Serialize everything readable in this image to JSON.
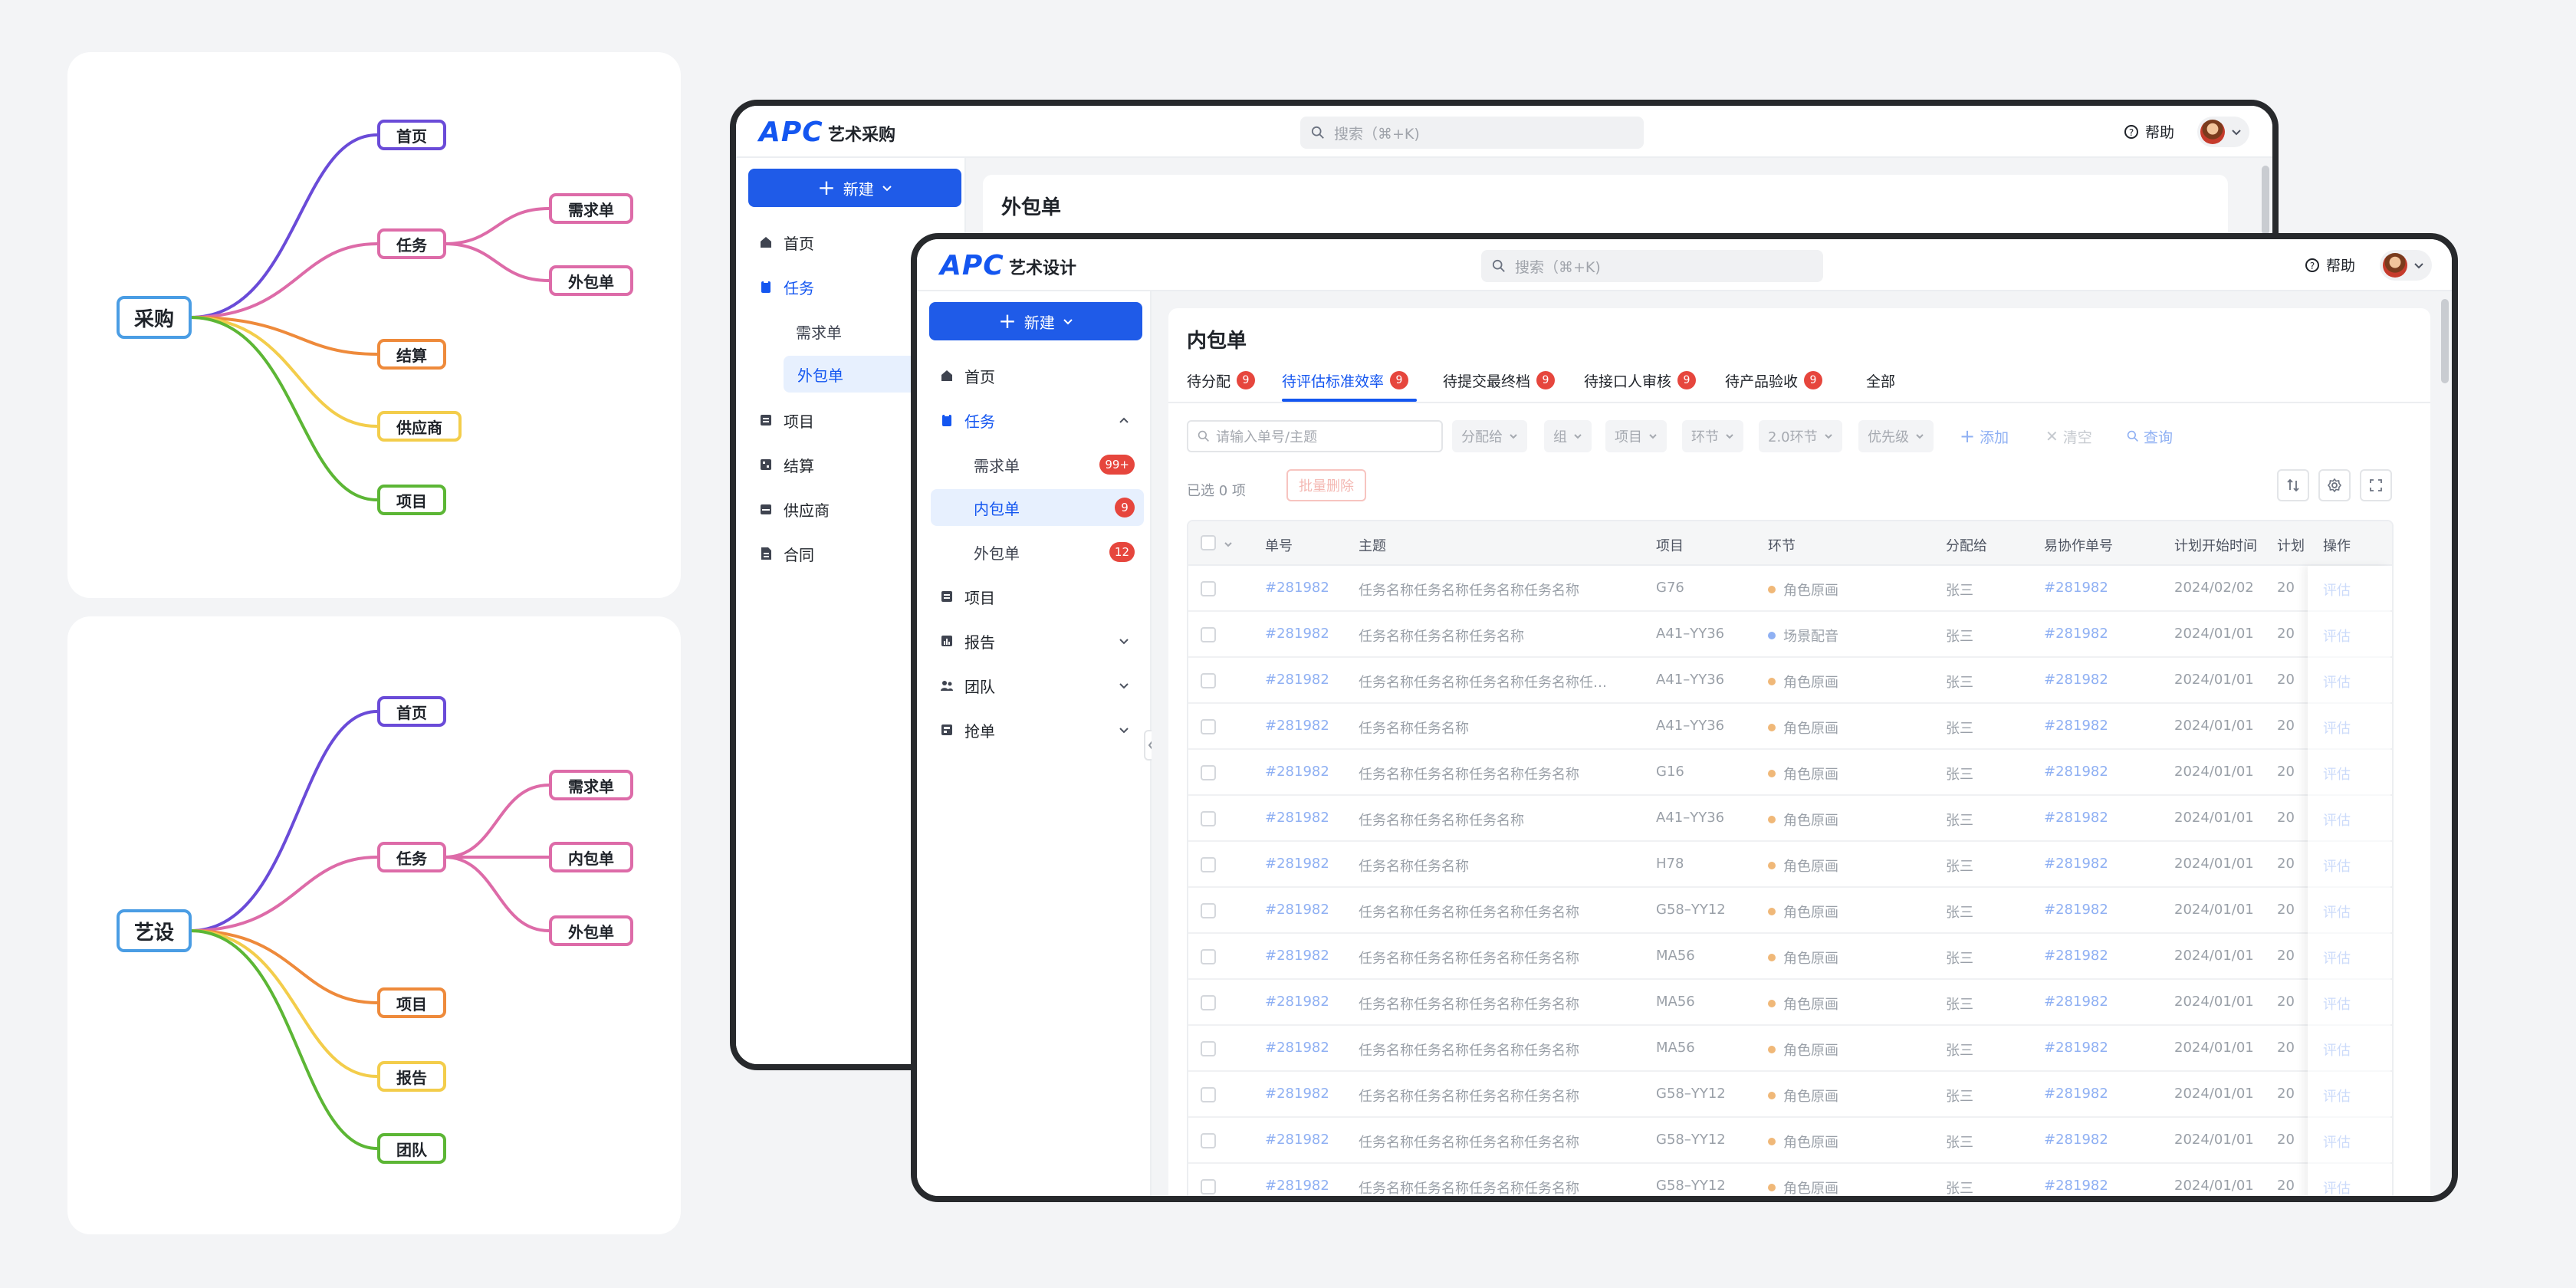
{
  "mindmaps": {
    "procurement": {
      "root": "采购",
      "nodes": [
        "首页",
        "任务",
        "需求单",
        "外包单",
        "结算",
        "供应商",
        "项目"
      ]
    },
    "design": {
      "root": "艺设",
      "nodes": [
        "首页",
        "任务",
        "需求单",
        "内包单",
        "外包单",
        "项目",
        "报告",
        "团队"
      ]
    }
  },
  "colors": {
    "accent": "#1456f0",
    "badge": "#e6463d",
    "frame": "#27292c",
    "branch_purple": "#6a4bd8",
    "branch_pink": "#dd6ba8",
    "branch_orange": "#ee8a3b",
    "branch_yellow": "#f3cd4b",
    "branch_green": "#5cb635",
    "root_blue": "#4a9de4"
  },
  "back_window": {
    "logo": "APC",
    "app_title": "艺术采购",
    "search_placeholder": "搜索（⌘+K)",
    "help": "帮助",
    "new_button": "新建",
    "nav": [
      {
        "label": "首页",
        "icon": "home-icon"
      },
      {
        "label": "任务",
        "icon": "task-icon"
      },
      {
        "label": "需求单"
      },
      {
        "label": "外包单"
      },
      {
        "label": "项目",
        "icon": "project-icon"
      },
      {
        "label": "结算",
        "icon": "settlement-icon"
      },
      {
        "label": "供应商",
        "icon": "supplier-icon"
      },
      {
        "label": "合同",
        "icon": "contract-icon"
      }
    ],
    "page_title": "外包单"
  },
  "front_window": {
    "logo": "APC",
    "app_title": "艺术设计",
    "search_placeholder": "搜索（⌘+K)",
    "help": "帮助",
    "new_button": "新建",
    "nav": [
      {
        "label": "首页",
        "icon": "home-icon"
      },
      {
        "label": "任务",
        "icon": "task-icon"
      },
      {
        "label": "需求单",
        "badge": "99+"
      },
      {
        "label": "内包单",
        "badge": "9"
      },
      {
        "label": "外包单",
        "badge": "12"
      },
      {
        "label": "项目",
        "icon": "project-icon"
      },
      {
        "label": "报告",
        "icon": "report-icon"
      },
      {
        "label": "团队",
        "icon": "team-icon"
      },
      {
        "label": "抢单",
        "icon": "grab-order-icon"
      }
    ],
    "page_title": "内包单",
    "tabs": [
      {
        "label": "待分配",
        "count": "9"
      },
      {
        "label": "待评估标准效率",
        "count": "9"
      },
      {
        "label": "待提交最终档",
        "count": "9"
      },
      {
        "label": "待接口人审核",
        "count": "9"
      },
      {
        "label": "待产品验收",
        "count": "9"
      },
      {
        "label": "全部"
      }
    ],
    "filters": {
      "search_placeholder": "请输入单号/主题",
      "dropdowns": [
        "分配给",
        "组",
        "项目",
        "环节",
        "2.0环节",
        "优先级"
      ],
      "add": "添加",
      "clear": "清空",
      "query": "查询"
    },
    "selected_info": "已选 0 项",
    "bulk_delete": "批量删除",
    "table": {
      "columns": [
        "单号",
        "主题",
        "项目",
        "环节",
        "分配给",
        "易协作单号",
        "计划开始时间",
        "计划",
        "操作"
      ],
      "rows": [
        {
          "id": "#281982",
          "subject": "任务名称任务名称任务名称任务名称",
          "project": "G76",
          "stage": "角色原画",
          "stage_color": "#f0b878",
          "assignee": "张三",
          "collab_id": "#281982",
          "start": "2024/02/02",
          "plan": "20",
          "op": "评估"
        },
        {
          "id": "#281982",
          "subject": "任务名称任务名称任务名称",
          "project": "A41–YY36",
          "stage": "场景配音",
          "stage_color": "#8fb0f3",
          "assignee": "张三",
          "collab_id": "#281982",
          "start": "2024/01/01",
          "plan": "20",
          "op": "评估"
        },
        {
          "id": "#281982",
          "subject": "任务名称任务名称任务名称任务名称任…",
          "project": "A41–YY36",
          "stage": "角色原画",
          "stage_color": "#f0b878",
          "assignee": "张三",
          "collab_id": "#281982",
          "start": "2024/01/01",
          "plan": "20",
          "op": "评估"
        },
        {
          "id": "#281982",
          "subject": "任务名称任务名称",
          "project": "A41–YY36",
          "stage": "角色原画",
          "stage_color": "#f0b878",
          "assignee": "张三",
          "collab_id": "#281982",
          "start": "2024/01/01",
          "plan": "20",
          "op": "评估"
        },
        {
          "id": "#281982",
          "subject": "任务名称任务名称任务名称任务名称",
          "project": "G16",
          "stage": "角色原画",
          "stage_color": "#f0b878",
          "assignee": "张三",
          "collab_id": "#281982",
          "start": "2024/01/01",
          "plan": "20",
          "op": "评估"
        },
        {
          "id": "#281982",
          "subject": "任务名称任务名称任务名称",
          "project": "A41–YY36",
          "stage": "角色原画",
          "stage_color": "#f0b878",
          "assignee": "张三",
          "collab_id": "#281982",
          "start": "2024/01/01",
          "plan": "20",
          "op": "评估"
        },
        {
          "id": "#281982",
          "subject": "任务名称任务名称",
          "project": "H78",
          "stage": "角色原画",
          "stage_color": "#f0b878",
          "assignee": "张三",
          "collab_id": "#281982",
          "start": "2024/01/01",
          "plan": "20",
          "op": "评估"
        },
        {
          "id": "#281982",
          "subject": "任务名称任务名称任务名称任务名称",
          "project": "G58–YY12",
          "stage": "角色原画",
          "stage_color": "#f0b878",
          "assignee": "张三",
          "collab_id": "#281982",
          "start": "2024/01/01",
          "plan": "20",
          "op": "评估"
        },
        {
          "id": "#281982",
          "subject": "任务名称任务名称任务名称任务名称",
          "project": "MA56",
          "stage": "角色原画",
          "stage_color": "#f0b878",
          "assignee": "张三",
          "collab_id": "#281982",
          "start": "2024/01/01",
          "plan": "20",
          "op": "评估"
        },
        {
          "id": "#281982",
          "subject": "任务名称任务名称任务名称任务名称",
          "project": "MA56",
          "stage": "角色原画",
          "stage_color": "#f0b878",
          "assignee": "张三",
          "collab_id": "#281982",
          "start": "2024/01/01",
          "plan": "20",
          "op": "评估"
        },
        {
          "id": "#281982",
          "subject": "任务名称任务名称任务名称任务名称",
          "project": "MA56",
          "stage": "角色原画",
          "stage_color": "#f0b878",
          "assignee": "张三",
          "collab_id": "#281982",
          "start": "2024/01/01",
          "plan": "20",
          "op": "评估"
        },
        {
          "id": "#281982",
          "subject": "任务名称任务名称任务名称任务名称",
          "project": "G58–YY12",
          "stage": "角色原画",
          "stage_color": "#f0b878",
          "assignee": "张三",
          "collab_id": "#281982",
          "start": "2024/01/01",
          "plan": "20",
          "op": "评估"
        },
        {
          "id": "#281982",
          "subject": "任务名称任务名称任务名称任务名称",
          "project": "G58–YY12",
          "stage": "角色原画",
          "stage_color": "#f0b878",
          "assignee": "张三",
          "collab_id": "#281982",
          "start": "2024/01/01",
          "plan": "20",
          "op": "评估"
        },
        {
          "id": "#281982",
          "subject": "任务名称任务名称任务名称任务名称",
          "project": "G58–YY12",
          "stage": "角色原画",
          "stage_color": "#f0b878",
          "assignee": "张三",
          "collab_id": "#281982",
          "start": "2024/01/01",
          "plan": "20",
          "op": "评估"
        }
      ]
    }
  }
}
